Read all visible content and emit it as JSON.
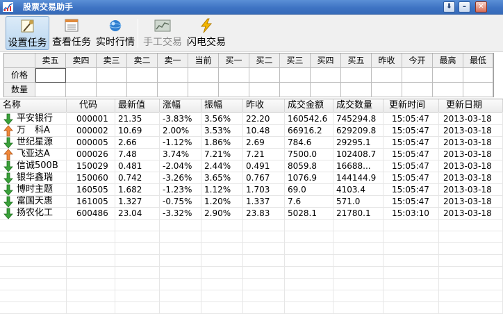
{
  "window": {
    "title": "股票交易助手"
  },
  "toolbar": {
    "buttons": [
      {
        "label": "设置任务",
        "icon": "settings-tool-icon",
        "active": true,
        "disabled": false
      },
      {
        "label": "查看任务",
        "icon": "task-list-icon",
        "active": false,
        "disabled": false
      },
      {
        "label": "实时行情",
        "icon": "globe-icon",
        "active": false,
        "disabled": false
      },
      {
        "label": "手工交易",
        "icon": "manual-trade-icon",
        "active": false,
        "disabled": true
      },
      {
        "label": "闪电交易",
        "icon": "lightning-icon",
        "active": false,
        "disabled": false
      }
    ]
  },
  "quote": {
    "headers": [
      "卖五",
      "卖四",
      "卖三",
      "卖二",
      "卖一",
      "当前",
      "买一",
      "买二",
      "买三",
      "买四",
      "买五",
      "昨收",
      "今开",
      "最高",
      "最低"
    ],
    "rows": [
      {
        "label": "价格"
      },
      {
        "label": "数量"
      }
    ]
  },
  "table": {
    "columns": [
      "名称",
      "代码",
      "最新值",
      "涨幅",
      "振幅",
      "昨收",
      "成交金额",
      "成交数量",
      "更新时间",
      "更新日期"
    ],
    "rows": [
      {
        "trend": "down",
        "cells": [
          "平安银行",
          "000001",
          "21.35",
          "-3.83%",
          "3.56%",
          "22.20",
          "160542.6",
          "745294.8",
          "15:05:47",
          "2013-03-18"
        ]
      },
      {
        "trend": "up",
        "cells": [
          "万　科A",
          "000002",
          "10.69",
          "2.00%",
          "3.53%",
          "10.48",
          "66916.2",
          "629209.8",
          "15:05:47",
          "2013-03-18"
        ]
      },
      {
        "trend": "down",
        "cells": [
          "世纪星源",
          "000005",
          "2.66",
          "-1.12%",
          "1.86%",
          "2.69",
          "784.6",
          "29295.1",
          "15:05:47",
          "2013-03-18"
        ]
      },
      {
        "trend": "up",
        "cells": [
          "飞亚达A",
          "000026",
          "7.48",
          "3.74%",
          "7.21%",
          "7.21",
          "7500.0",
          "102408.7",
          "15:05:47",
          "2013-03-18"
        ]
      },
      {
        "trend": "down",
        "cells": [
          "信诚500B",
          "150029",
          "0.481",
          "-2.04%",
          "2.44%",
          "0.491",
          "8059.8",
          "16688...",
          "15:05:47",
          "2013-03-18"
        ]
      },
      {
        "trend": "down",
        "cells": [
          "银华鑫瑞",
          "150060",
          "0.742",
          "-3.26%",
          "3.65%",
          "0.767",
          "1076.9",
          "144144.9",
          "15:05:47",
          "2013-03-18"
        ]
      },
      {
        "trend": "down",
        "cells": [
          "博时主题",
          "160505",
          "1.682",
          "-1.23%",
          "1.12%",
          "1.703",
          "69.0",
          "4103.4",
          "15:05:47",
          "2013-03-18"
        ]
      },
      {
        "trend": "down",
        "cells": [
          "富国天惠",
          "161005",
          "1.327",
          "-0.75%",
          "1.20%",
          "1.337",
          "7.6",
          "571.0",
          "15:05:47",
          "2013-03-18"
        ]
      },
      {
        "trend": "down",
        "cells": [
          "扬农化工",
          "600486",
          "23.04",
          "-3.32%",
          "2.90%",
          "23.83",
          "5028.1",
          "21780.1",
          "15:03:10",
          "2013-03-18"
        ]
      }
    ]
  },
  "colors": {
    "up": "#f0883a",
    "down": "#3aa23a",
    "titlebar": "#3f74c4"
  }
}
